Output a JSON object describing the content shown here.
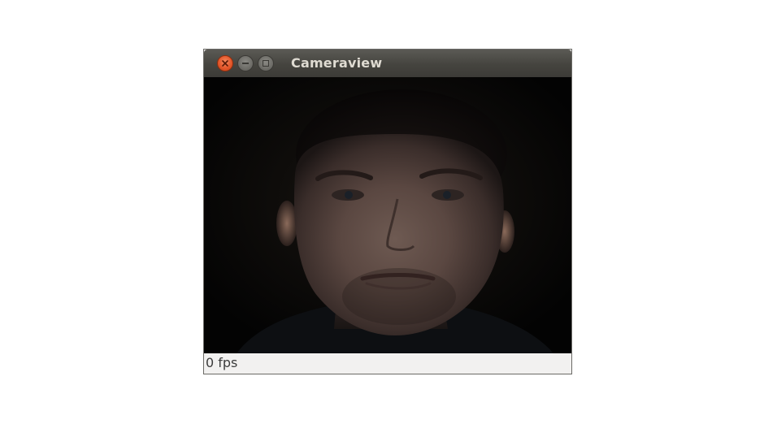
{
  "window": {
    "title": "Cameraview",
    "controls": {
      "close_icon": "close-icon",
      "minimize_icon": "minimize-icon",
      "maximize_icon": "maximize-icon"
    }
  },
  "camera": {
    "content": "webcam-frame"
  },
  "status": {
    "text": "0 fps"
  },
  "colors": {
    "titlebar": "#3c3b37",
    "close_button": "#e4572b",
    "title_text": "#dfdbd2",
    "statusbar": "#f2f1f0",
    "camera_background": "#050404"
  }
}
